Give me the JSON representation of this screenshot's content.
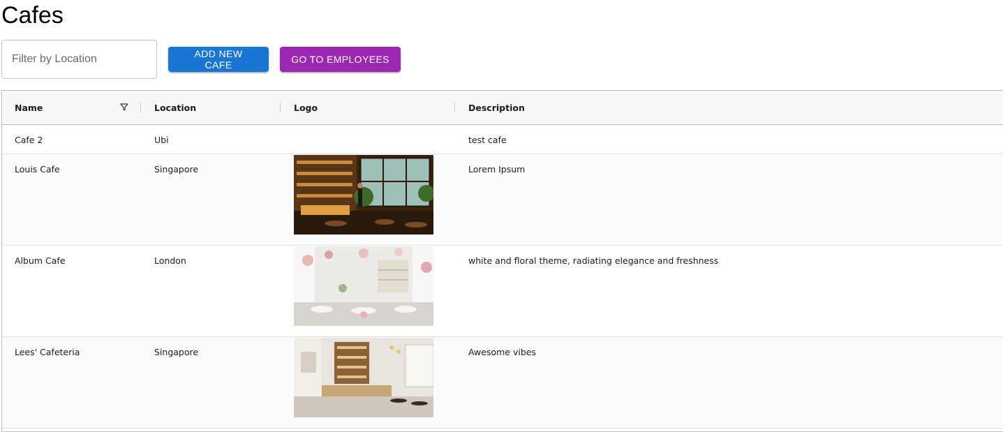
{
  "page": {
    "title": "Cafes"
  },
  "toolbar": {
    "filter_placeholder": "Filter by Location",
    "filter_value": "",
    "add_label": "ADD NEW CAFE",
    "employees_label": "GO TO EMPLOYEES",
    "add_color": "#1976d2",
    "employees_color": "#9c27b0"
  },
  "table": {
    "columns": [
      "Name",
      "Location",
      "Logo",
      "Description"
    ],
    "rows": [
      {
        "name": "Cafe 2",
        "location": "Ubi",
        "logo": "",
        "description": "test cafe"
      },
      {
        "name": "Louis Cafe",
        "location": "Singapore",
        "logo": "cafe-interior-warm-photo",
        "description": "Lorem Ipsum"
      },
      {
        "name": "Album Cafe",
        "location": "London",
        "logo": "cafe-interior-floral-photo",
        "description": "white and floral theme, radiating elegance and freshness"
      },
      {
        "name": "Lees' Cafeteria",
        "location": "Singapore",
        "logo": "cafe-interior-modern-photo",
        "description": "Awesome vibes"
      }
    ]
  },
  "icons": {
    "name_filter": "filter-icon"
  }
}
